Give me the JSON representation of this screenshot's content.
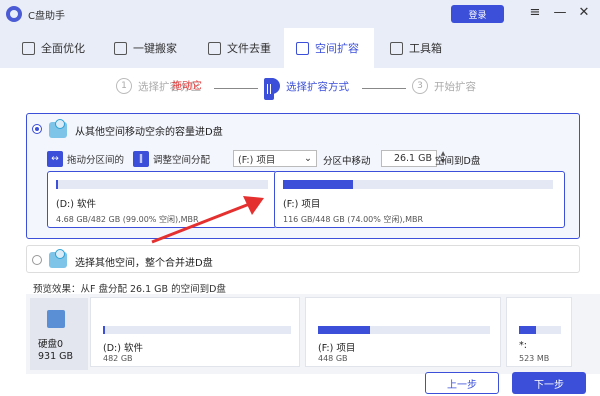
{
  "app": {
    "title": "C盘助手",
    "login_label": "登录"
  },
  "window": {
    "menu_icon": "menu-icon",
    "minimize_icon": "minimize-icon",
    "close_icon": "close-icon"
  },
  "tabs": [
    {
      "label": "全面优化",
      "icon": "optimize-icon",
      "active": false
    },
    {
      "label": "一键搬家",
      "icon": "truck-icon",
      "active": false
    },
    {
      "label": "文件去重",
      "icon": "file-icon",
      "active": false
    },
    {
      "label": "空间扩容",
      "icon": "expand-icon",
      "active": true
    },
    {
      "label": "工具箱",
      "icon": "toolbox-icon",
      "active": false
    }
  ],
  "steps": [
    {
      "num": "1",
      "label": "选择扩容分区"
    },
    {
      "num": "2",
      "label": "选择扩容方式"
    },
    {
      "num": "3",
      "label": "开始扩容"
    }
  ],
  "option1": {
    "label": "从其他空间移动空余的容量进D盘",
    "drag_label": "拖动分区间的",
    "adjust_label": "调整空间分配",
    "partition_select": "(F:) 项目",
    "move_label": "分区中移动",
    "amount": "26.1 GB",
    "to_label": "空间到D盘",
    "drag_hint": "拖动它",
    "left_partition": {
      "label": "(D:) 软件",
      "info": "4.68 GB/482 GB (99.00% 空闲),MBR",
      "used_fraction": 0.01
    },
    "right_partition": {
      "label": "(F:) 项目",
      "info": "116 GB/448 GB (74.00% 空闲),MBR",
      "used_fraction": 0.26
    }
  },
  "option2": {
    "label": "选择其他空间，整个合并进D盘"
  },
  "preview": {
    "label": "预览效果：从F 盘分配 26.1 GB 的空间到D盘",
    "disk": {
      "name": "硬盘0",
      "size": "931 GB"
    },
    "partitions": [
      {
        "label": "(D:) 软件",
        "size": "482 GB",
        "used_fraction": 0.01
      },
      {
        "label": "(F:) 项目",
        "size": "448 GB",
        "used_fraction": 0.3
      },
      {
        "label": "*:",
        "size": "523 MB",
        "used_fraction": 0.4
      }
    ]
  },
  "footer": {
    "prev_label": "上一步",
    "next_label": "下一步"
  },
  "colors": {
    "accent": "#3b4fd8",
    "hint": "#e53030"
  }
}
